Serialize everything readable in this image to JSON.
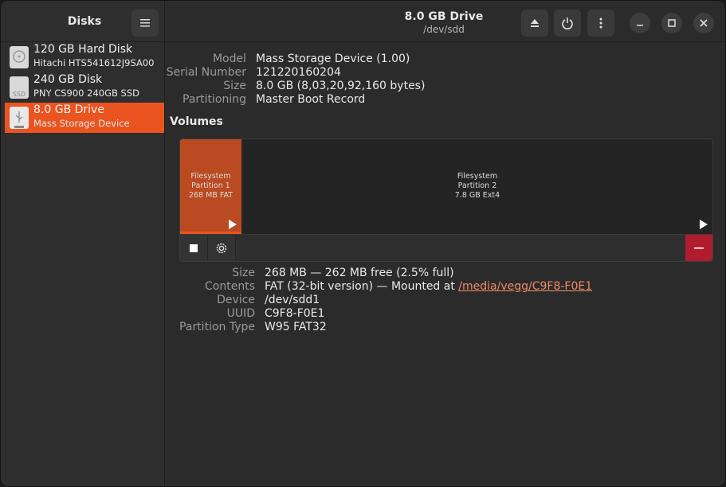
{
  "sidebar": {
    "title": "Disks",
    "disks": [
      {
        "name": "120 GB Hard Disk",
        "model": "Hitachi HTS541612J9SA00",
        "icon": "harddisk-icon"
      },
      {
        "name": "240 GB Disk",
        "model": "PNY CS900 240GB SSD",
        "icon": "ssd-icon",
        "icon_text": "SSD"
      },
      {
        "name": "8.0 GB Drive",
        "model": "Mass Storage Device",
        "icon": "usb-drive-icon"
      }
    ]
  },
  "header": {
    "title": "8.0 GB Drive",
    "subtitle": "/dev/sdd"
  },
  "drive_info": [
    {
      "label": "Model",
      "value": "Mass Storage Device (1.00)"
    },
    {
      "label": "Serial Number",
      "value": "121220160204"
    },
    {
      "label": "Size",
      "value": "8.0 GB (8,03,20,92,160 bytes)"
    },
    {
      "label": "Partitioning",
      "value": "Master Boot Record"
    }
  ],
  "volumes": {
    "title": "Volumes",
    "partitions": [
      {
        "l1": "Filesystem",
        "l2": "Partition 1",
        "l3": "268 MB FAT"
      },
      {
        "l1": "Filesystem",
        "l2": "Partition 2",
        "l3": "7.8 GB Ext4"
      }
    ]
  },
  "partition_info": {
    "size_label": "Size",
    "size_value": "268 MB — 262 MB free (2.5% full)",
    "contents_label": "Contents",
    "contents_value": "FAT (32-bit version) — Mounted at ",
    "mount_link": "/media/vegg/C9F8-F0E1",
    "device_label": "Device",
    "device_value": "/dev/sdd1",
    "uuid_label": "UUID",
    "uuid_value": "C9F8-F0E1",
    "type_label": "Partition Type",
    "type_value": "W95 FAT32"
  },
  "colors": {
    "accent": "#e95420",
    "danger": "#b01c2e",
    "link": "#f08a68"
  }
}
